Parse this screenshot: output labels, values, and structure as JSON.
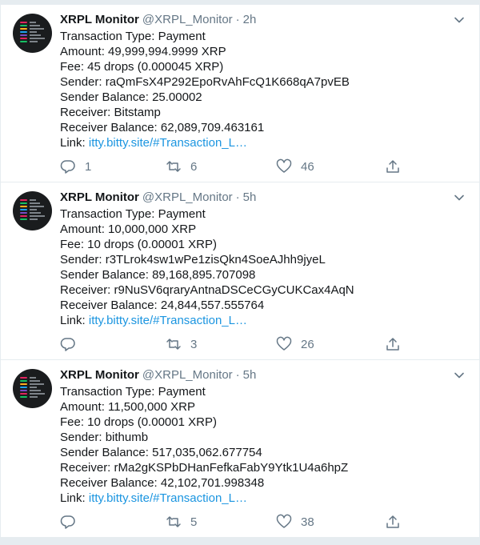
{
  "tweets": [
    {
      "name": "XRPL Monitor",
      "handle": "@XRPL_Monitor",
      "separator": "·",
      "time": "2h",
      "lines": [
        "Transaction Type: Payment",
        "Amount: 49,999,994.9999 XRP",
        "Fee: 45 drops (0.000045 XRP)",
        "Sender: raQmFsX4P292EpoRvAhFcQ1K668qA7pvEB",
        "Sender Balance: 25.00002",
        "Receiver: Bitstamp",
        "Receiver Balance: 62,089,709.463161"
      ],
      "link_label": "Link: ",
      "link_text": "itty.bitty.site/#Transaction_L…",
      "reply_count": "1",
      "retweet_count": "6",
      "like_count": "46"
    },
    {
      "name": "XRPL Monitor",
      "handle": "@XRPL_Monitor",
      "separator": "·",
      "time": "5h",
      "lines": [
        "Transaction Type: Payment",
        "Amount: 10,000,000 XRP",
        "Fee: 10 drops (0.00001 XRP)",
        "Sender: r3TLrok4sw1wPe1zisQkn4SoeAJhh9jyeL",
        "Sender Balance: 89,168,895.707098",
        "Receiver: r9NuSV6qraryAntnaDSCeCGyCUKCax4AqN",
        "Receiver Balance: 24,844,557.555764"
      ],
      "link_label": "Link: ",
      "link_text": "itty.bitty.site/#Transaction_L…",
      "reply_count": "",
      "retweet_count": "3",
      "like_count": "26"
    },
    {
      "name": "XRPL Monitor",
      "handle": "@XRPL_Monitor",
      "separator": "·",
      "time": "5h",
      "lines": [
        "Transaction Type: Payment",
        "Amount: 11,500,000 XRP",
        "Fee: 10 drops (0.00001 XRP)",
        "Sender: bithumb",
        "Sender Balance: 517,035,062.677754",
        "Receiver: rMa2gKSPbDHanFefkaFabY9Ytk1U4a6hpZ",
        "Receiver Balance: 42,102,701.998348"
      ],
      "link_label": "Link: ",
      "link_text": "itty.bitty.site/#Transaction_L…",
      "reply_count": "",
      "retweet_count": "5",
      "like_count": "38"
    }
  ],
  "icons": {
    "caret": "chevron-down-icon",
    "reply": "reply-icon",
    "retweet": "retweet-icon",
    "like": "heart-icon",
    "share": "share-icon"
  },
  "colors": {
    "link": "#1b95e0",
    "secondary_text": "#657786",
    "background": "#e6ecf0"
  }
}
